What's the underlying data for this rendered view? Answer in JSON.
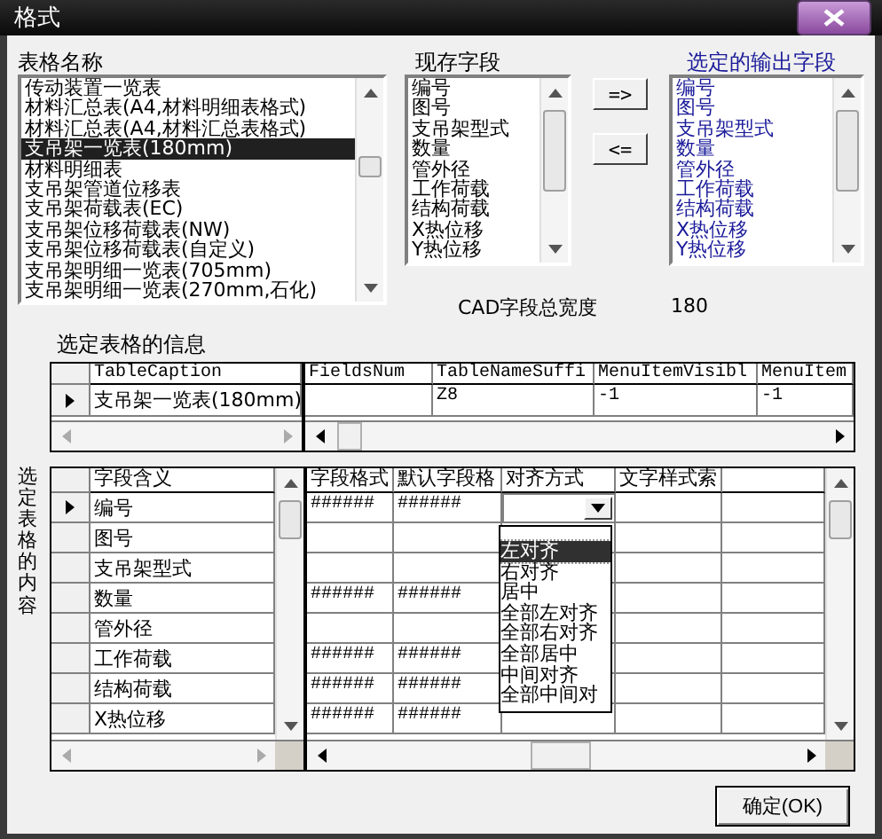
{
  "window": {
    "title": "格式"
  },
  "table_names": {
    "label": "表格名称",
    "items": [
      {
        "text": "传动装置一览表",
        "selected": false
      },
      {
        "text": "材料汇总表(A4,材料明细表格式)",
        "selected": false
      },
      {
        "text": "材料汇总表(A4,材料汇总表格式)",
        "selected": false
      },
      {
        "text": "支吊架一览表(180mm)",
        "selected": true
      },
      {
        "text": "材料明细表",
        "selected": false
      },
      {
        "text": "支吊架管道位移表",
        "selected": false
      },
      {
        "text": "支吊架荷载表(EC)",
        "selected": false
      },
      {
        "text": "支吊架位移荷载表(NW)",
        "selected": false
      },
      {
        "text": "支吊架位移荷载表(自定义)",
        "selected": false
      },
      {
        "text": "支吊架明细一览表(705mm)",
        "selected": false
      },
      {
        "text": "支吊架明细一览表(270mm,石化)",
        "selected": false
      }
    ]
  },
  "existing_fields": {
    "label": "现存字段",
    "items": [
      "编号",
      "图号",
      "支吊架型式",
      "数量",
      "管外径",
      "工作荷载",
      "结构荷载",
      "X热位移",
      "Y热位移"
    ]
  },
  "transfer_buttons": [
    "=>",
    "<="
  ],
  "output_fields": {
    "label": "选定的输出字段",
    "items": [
      "编号",
      "图号",
      "支吊架型式",
      "数量",
      "管外径",
      "工作荷载",
      "结构荷载",
      "X热位移",
      "Y热位移"
    ]
  },
  "cad_width": {
    "label": "CAD字段总宽度",
    "value": "180"
  },
  "table_info": {
    "label": "选定表格的信息",
    "columns": [
      "TableCaption",
      "FieldsNum",
      "TableNameSuffi",
      "MenuItemVisibl",
      "MenuItem"
    ],
    "rows": [
      {
        "current": true,
        "cells": [
          "支吊架一览表(180mm)",
          "",
          "Z8",
          "-1",
          "-1"
        ]
      }
    ]
  },
  "table_content": {
    "label": "选定表格的内容",
    "columns": [
      "字段含义",
      "字段格式",
      "默认字段格",
      "对齐方式",
      "文字样式索"
    ],
    "rows": [
      {
        "current": true,
        "cells": [
          "编号",
          "######",
          "######",
          "",
          ""
        ]
      },
      {
        "current": false,
        "cells": [
          "图号",
          "",
          "",
          "",
          ""
        ]
      },
      {
        "current": false,
        "cells": [
          "支吊架型式",
          "",
          "",
          "",
          ""
        ]
      },
      {
        "current": false,
        "cells": [
          "数量",
          "######",
          "######",
          "",
          ""
        ]
      },
      {
        "current": false,
        "cells": [
          "管外径",
          "",
          "",
          "",
          ""
        ]
      },
      {
        "current": false,
        "cells": [
          "工作荷载",
          "######",
          "######",
          "",
          ""
        ]
      },
      {
        "current": false,
        "cells": [
          "结构荷载",
          "######",
          "######",
          "",
          ""
        ]
      },
      {
        "current": false,
        "cells": [
          "X热位移",
          "######",
          "######",
          "",
          ""
        ]
      }
    ],
    "align_options": [
      {
        "text": "左对齐",
        "selected": true
      },
      {
        "text": "右对齐",
        "selected": false
      },
      {
        "text": "居中",
        "selected": false
      },
      {
        "text": "全部左对齐",
        "selected": false
      },
      {
        "text": "全部右对齐",
        "selected": false
      },
      {
        "text": "全部居中",
        "selected": false
      },
      {
        "text": "中间对齐",
        "selected": false
      },
      {
        "text": "全部中间对",
        "selected": false
      }
    ]
  },
  "ok_button": "确定(OK)"
}
